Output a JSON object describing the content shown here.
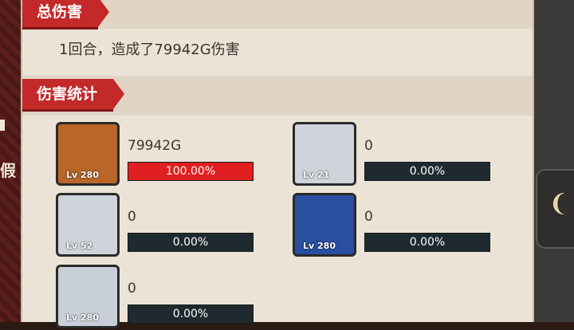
{
  "backdrop": {
    "left_text": "假"
  },
  "summary_section": {
    "title": "总伤害",
    "text": "1回合，造成了79942G伤害"
  },
  "stats_section": {
    "title": "伤害统计"
  },
  "heroes": [
    {
      "level": "Lv 280",
      "damage": "79942G",
      "percent": "100.00%",
      "fill": 1.0,
      "portrait_bg": "#b8662a",
      "portrait_icon": "golden-warrior"
    },
    {
      "level": "Lv 21",
      "damage": "0",
      "percent": "0.00%",
      "fill": 0,
      "portrait_bg": "#cfd4da",
      "portrait_icon": "white-hair-hero"
    },
    {
      "level": "Lv 52",
      "damage": "0",
      "percent": "0.00%",
      "fill": 0,
      "portrait_bg": "#cfd4da",
      "portrait_icon": "white-hair-hero"
    },
    {
      "level": "Lv 280",
      "damage": "0",
      "percent": "0.00%",
      "fill": 0,
      "portrait_bg": "#2a4ea0",
      "portrait_icon": "blonde-mage"
    },
    {
      "level": "Lv 280",
      "damage": "0",
      "percent": "0.00%",
      "fill": 0,
      "portrait_bg": "#c9cfd8",
      "portrait_icon": "blonde-maid"
    }
  ]
}
